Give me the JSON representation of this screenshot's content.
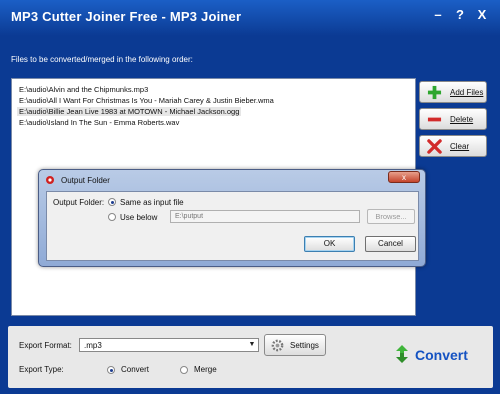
{
  "window": {
    "title": "MP3 Cutter Joiner Free   -   MP3 Joiner",
    "minimize": "–",
    "help": "?",
    "close": "X"
  },
  "instruction": "Files to be converted/merged in the following order:",
  "files": [
    "E:\\audio\\Alvin and the Chipmunks.mp3",
    "E:\\audio\\All I Want For Christmas Is You - Mariah Carey & Justin Bieber.wma",
    "E:\\audio\\Billie Jean Live 1983 at MOTOWN - Michael Jackson.ogg",
    "E:\\audio\\Island In The Sun - Emma Roberts.wav"
  ],
  "side_buttons": {
    "add": "Add Files",
    "delete": "Delete",
    "clear": "Clear"
  },
  "bottom": {
    "export_format_label": "Export Format:",
    "export_format_value": ".mp3",
    "settings": "Settings",
    "export_type_label": "Export Type:",
    "convert_option": "Convert",
    "merge_option": "Merge",
    "convert_button": "Convert"
  },
  "dialog": {
    "title": "Output Folder",
    "close": "x",
    "output_folder_label": "Output Folder:",
    "same_as_input": "Same as input file",
    "use_below": "Use below",
    "path_value": "E:\\putput",
    "browse": "Browse...",
    "ok": "OK",
    "cancel": "Cancel"
  }
}
